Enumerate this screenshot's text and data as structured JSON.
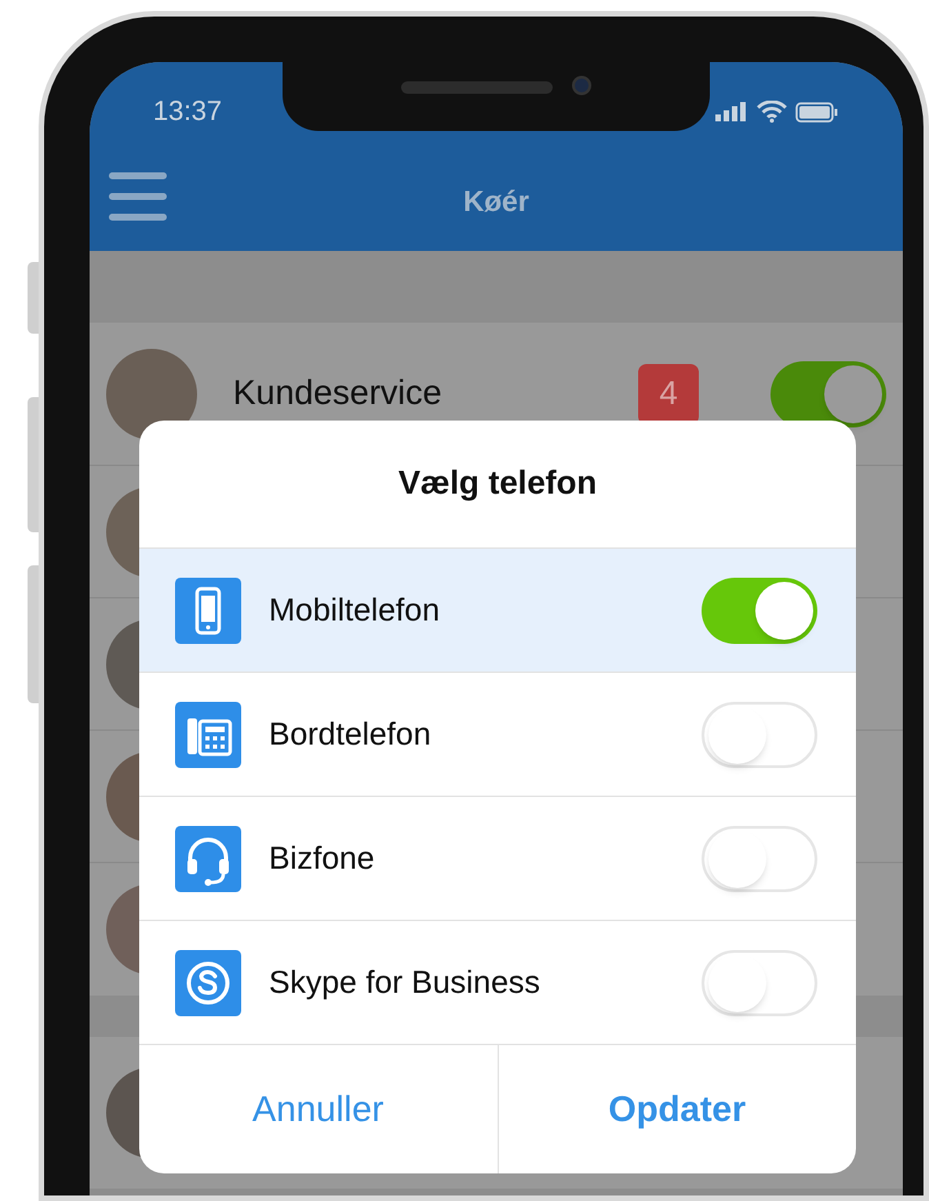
{
  "status_bar": {
    "time": "13:37"
  },
  "header": {
    "title": "Køér"
  },
  "queues": [
    {
      "name": "Kundeservice",
      "badge": "4",
      "on": true
    }
  ],
  "dialog": {
    "title": "Vælg telefon",
    "options": [
      {
        "kind": "mobile",
        "label": "Mobiltelefon",
        "on": true
      },
      {
        "kind": "desk",
        "label": "Bordtelefon",
        "on": false
      },
      {
        "kind": "headset",
        "label": "Bizfone",
        "on": false
      },
      {
        "kind": "skype",
        "label": "Skype for Business",
        "on": false
      }
    ],
    "buttons": [
      {
        "label": "Annuller",
        "primary": false
      },
      {
        "label": "Opdater",
        "primary": true
      }
    ]
  }
}
